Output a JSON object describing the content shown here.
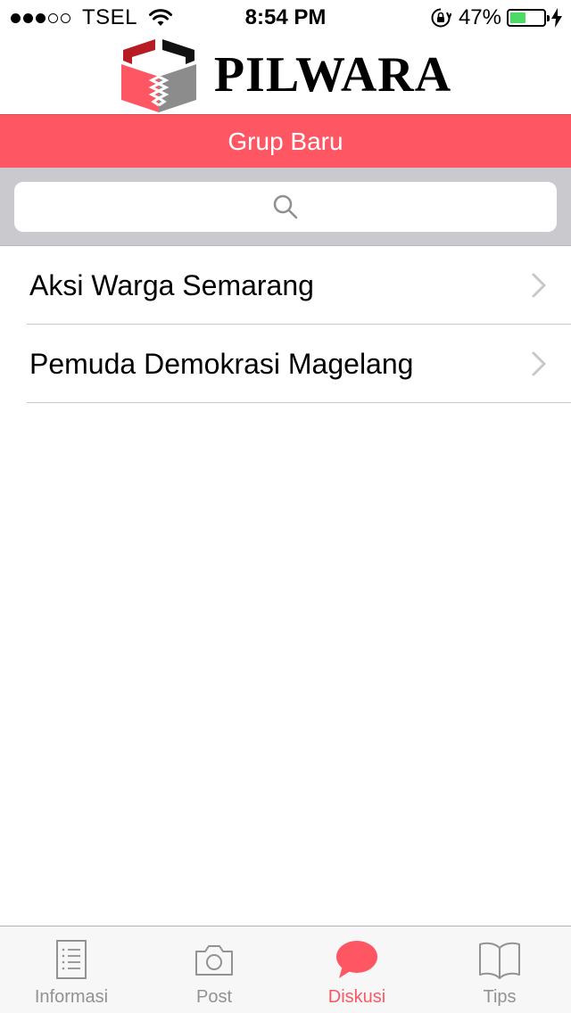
{
  "status_bar": {
    "carrier": "TSEL",
    "signal_full": 3,
    "signal_total": 5,
    "time": "8:54 PM",
    "battery_pct_text": "47%",
    "battery_level": 0.47,
    "battery_color": "#4cd964",
    "icons": [
      "wifi-icon",
      "rotation-lock-icon",
      "battery-icon",
      "charging-bolt-icon"
    ]
  },
  "header": {
    "app_name": "PILWARA",
    "logo_icon": "ballot-box-logo-icon"
  },
  "nav": {
    "title": "Grup Baru",
    "color": "#fe5763"
  },
  "search": {
    "value": "",
    "placeholder": "",
    "icon": "search-icon"
  },
  "groups": [
    {
      "name": "Aksi Warga Semarang"
    },
    {
      "name": "Pemuda Demokrasi Magelang"
    }
  ],
  "tab_bar": {
    "active_color": "#fe5763",
    "inactive_color": "#929292",
    "tabs": [
      {
        "label": "Informasi",
        "icon": "list-document-icon",
        "active": false
      },
      {
        "label": "Post",
        "icon": "camera-icon",
        "active": false
      },
      {
        "label": "Diskusi",
        "icon": "chat-bubble-icon",
        "active": true
      },
      {
        "label": "Tips",
        "icon": "book-icon",
        "active": false
      }
    ]
  }
}
